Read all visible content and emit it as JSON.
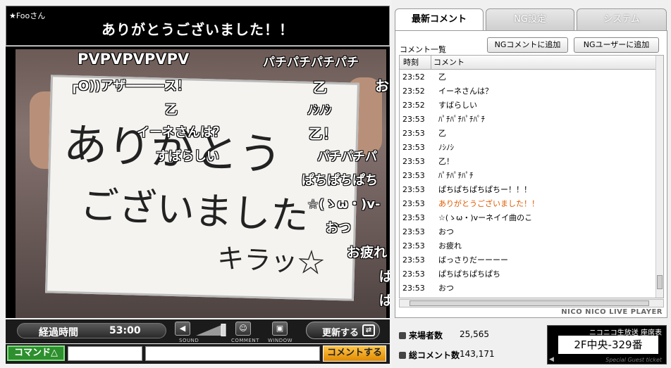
{
  "player": {
    "owner_name": "★Fooさん",
    "stream_title": "ありがとうございました！！",
    "video": {
      "whiteboard_lines": [
        "ありがとう",
        "ございました",
        "キラッ☆"
      ],
      "danmaku": [
        "PVPVPVPVPV",
        "パチパチパチパチ",
        "┏O))アザ━━━━━ス！",
        "乙",
        "お",
        "乙",
        "ﾉｼﾉｼ",
        "イーネさんは？",
        "乙！",
        "すばらしい",
        "パチパチパ",
        "ぱちぱちぱち",
        "☆(ゝω・)v-",
        "おつ",
        "お疲れ",
        "ば",
        "ぱ"
      ]
    },
    "controls": {
      "elapsed_label": "経過時間",
      "elapsed_time": "53:00",
      "sound_label": "SOUND",
      "comment_label": "COMMENT",
      "window_label": "WINDOW",
      "refresh_label": "更新する"
    },
    "comment_bar": {
      "command_label": "コマンド△",
      "submit_label": "コメントする"
    }
  },
  "side": {
    "tabs": [
      "最新コメント",
      "NG設定",
      "システム"
    ],
    "list_title": "コメント一覧",
    "ng_comment_button": "NGコメントに追加",
    "ng_user_button": "NGユーザーに追加",
    "columns": {
      "time": "時刻",
      "comment": "コメント"
    },
    "rows": [
      {
        "time": "23:52",
        "comment": "乙",
        "highlight": false
      },
      {
        "time": "23:52",
        "comment": "イーネさんは？",
        "highlight": false
      },
      {
        "time": "23:52",
        "comment": "すばらしい",
        "highlight": false
      },
      {
        "time": "23:53",
        "comment": "ﾊﾟﾁﾊﾟﾁﾊﾟﾁﾊﾟﾁ",
        "highlight": false
      },
      {
        "time": "23:53",
        "comment": "乙",
        "highlight": false
      },
      {
        "time": "23:53",
        "comment": "ﾉｼﾉｼ",
        "highlight": false
      },
      {
        "time": "23:53",
        "comment": "乙！",
        "highlight": false
      },
      {
        "time": "23:53",
        "comment": "ﾊﾟﾁﾊﾟﾁﾊﾟﾁ",
        "highlight": false
      },
      {
        "time": "23:53",
        "comment": "ぱちぱちぱちぱちー！！！",
        "highlight": false
      },
      {
        "time": "23:53",
        "comment": "ありがとうございました！！",
        "highlight": true
      },
      {
        "time": "23:53",
        "comment": "☆(ゝω・)vーネイイ曲のこ",
        "highlight": false
      },
      {
        "time": "23:53",
        "comment": "おつ",
        "highlight": false
      },
      {
        "time": "23:53",
        "comment": "お疲れ",
        "highlight": false
      },
      {
        "time": "23:53",
        "comment": "ばっさりだーーーー",
        "highlight": false
      },
      {
        "time": "23:53",
        "comment": "ぱちぱちぱちぱち",
        "highlight": false
      },
      {
        "time": "23:53",
        "comment": "おつ",
        "highlight": false
      }
    ],
    "player_brand": "NICO NICO LIVE PLAYER",
    "stats": {
      "visitors_label": "来場者数",
      "visitors_value": "25,565",
      "comments_label": "総コメント数",
      "comments_value": "143,171"
    },
    "ticket": {
      "header": "ニコニコ生放送 座席表",
      "seat": "2F中央-329番",
      "footer": "Special Guest ticket"
    }
  },
  "colors": {
    "highlight_comment": "#e05a00",
    "command_green": "#2d8f2d",
    "submit_orange": "#f0a020"
  }
}
